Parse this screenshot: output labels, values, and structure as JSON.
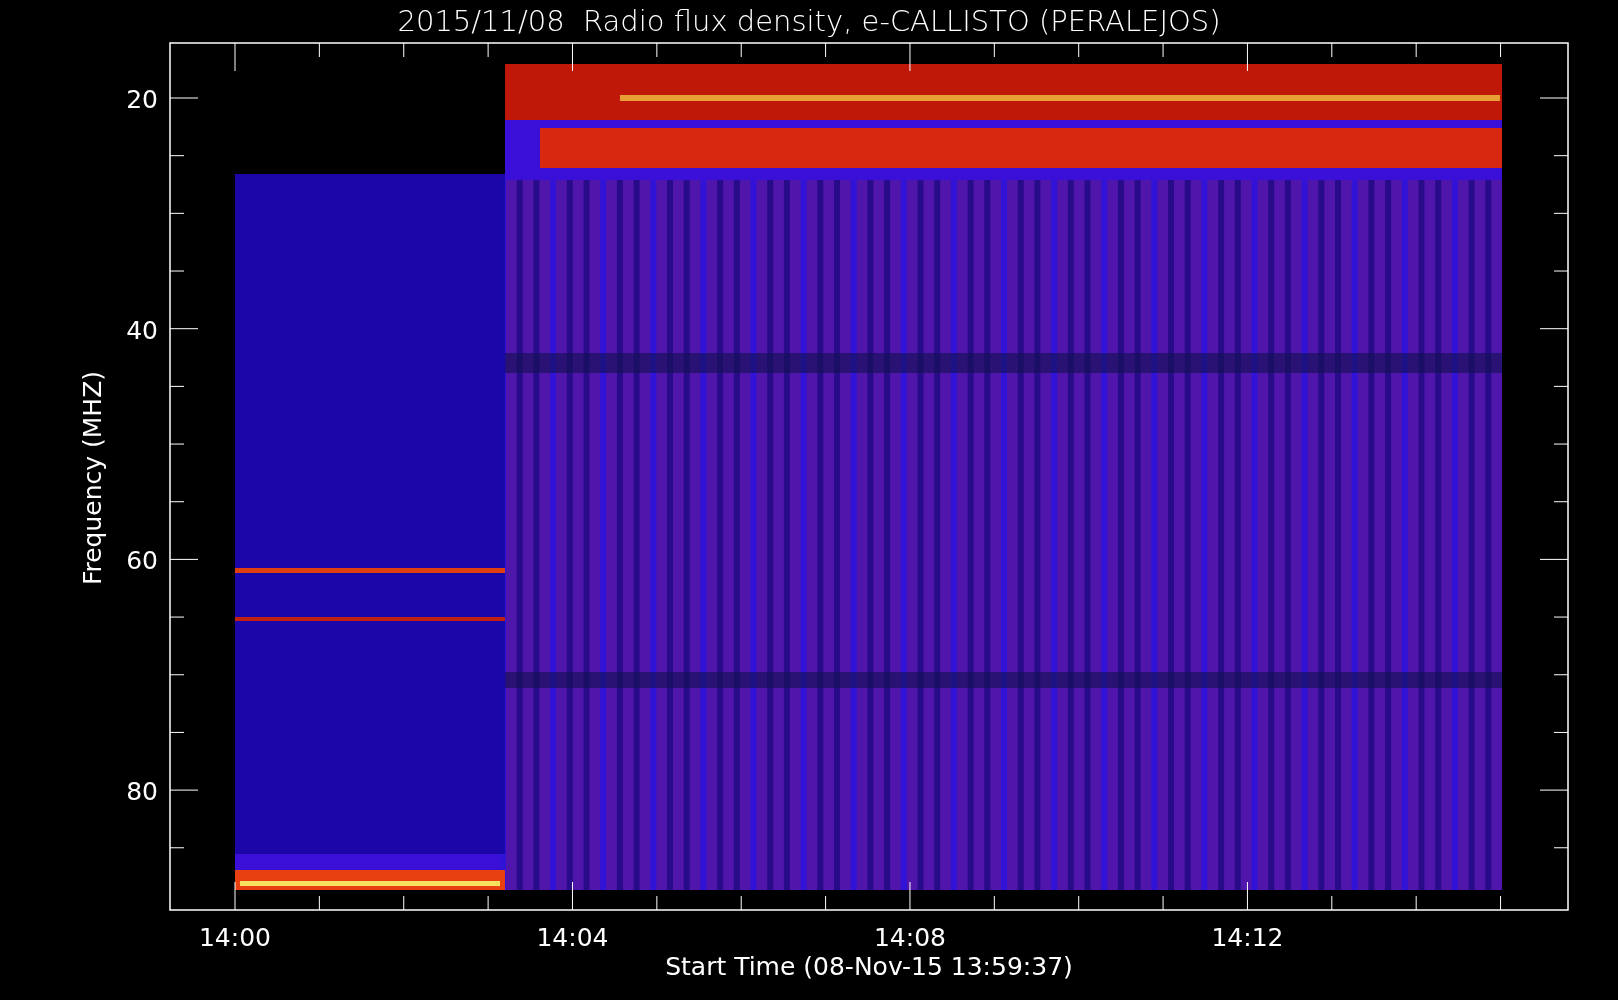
{
  "title": "2015/11/08  Radio flux density, e-CALLISTO (PERALEJOS)",
  "y_axis": {
    "label": "Frequency (MHZ)",
    "ticks": [
      "20",
      "40",
      "60",
      "80"
    ]
  },
  "x_axis": {
    "label": "Start Time (08-Nov-15 13:59:37)",
    "ticks": [
      "14:00",
      "14:04",
      "14:08",
      "14:12"
    ]
  }
}
